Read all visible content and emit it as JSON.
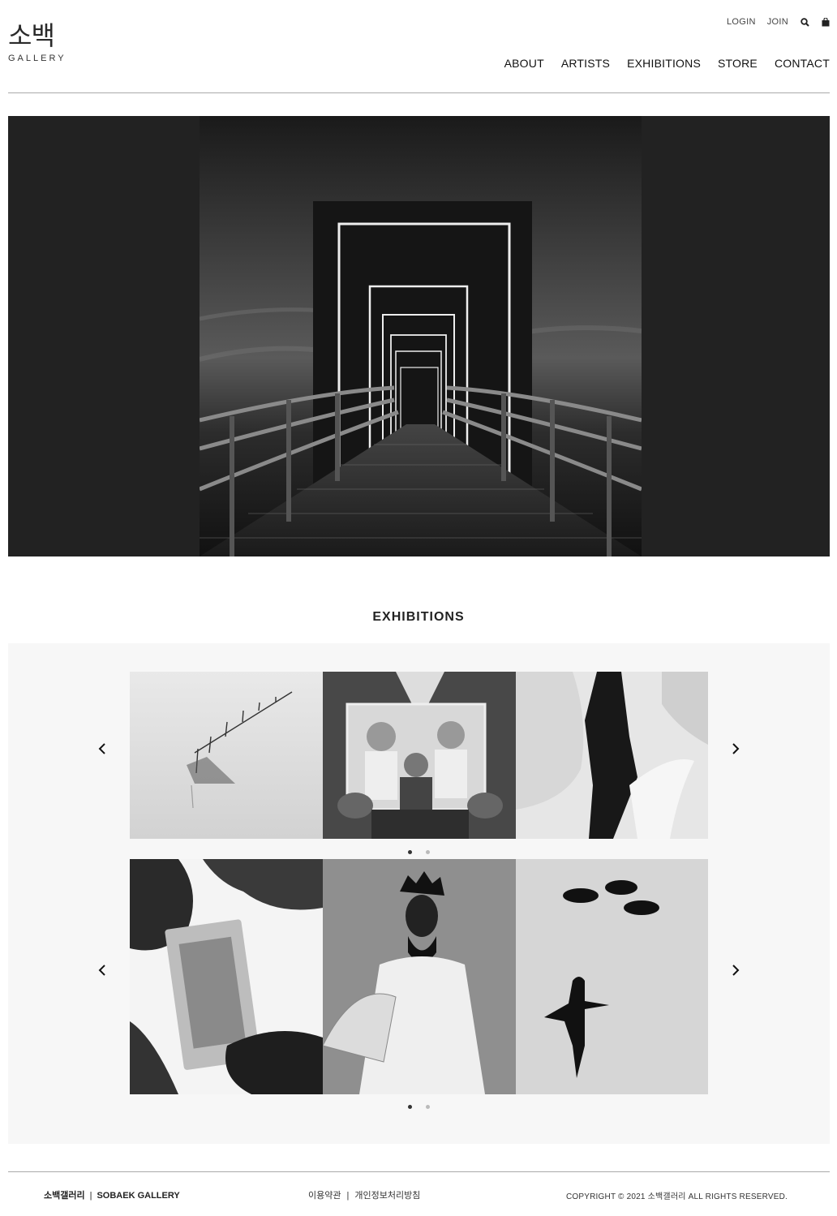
{
  "brand": {
    "logo_ko": "소백",
    "logo_en": "GALLERY"
  },
  "util_nav": {
    "login": "LOGIN",
    "join": "JOIN",
    "search_icon": "search-icon",
    "cart_icon": "bag-icon"
  },
  "nav": {
    "items": [
      "ABOUT",
      "ARTISTS",
      "EXHIBITIONS",
      "STORE",
      "CONTACT"
    ]
  },
  "hero": {
    "image": "black-and-white pier with illuminated square frames"
  },
  "exhibitions": {
    "title": "EXHIBITIONS",
    "slider_1": {
      "images": [
        "misty fence in water",
        "man holding family portrait",
        "ice formations"
      ],
      "page": 1,
      "pages": 2
    },
    "slider_2": {
      "images": [
        "fingers holding film negative",
        "masked dancer with fan",
        "swimmer beneath ducks"
      ],
      "page": 1,
      "pages": 2
    },
    "prev_icon": "chevron-left-icon",
    "next_icon": "chevron-right-icon"
  },
  "footer": {
    "name_ko": "소백갤러리",
    "name_en": "SOBAEK GALLERY",
    "terms": "이용약관",
    "privacy": "개인정보처리방침",
    "copyright": "COPYRIGHT © 2021 소백갤러리 ALL RIGHTS RESERVED."
  },
  "colors": {
    "hero_bg": "#222222",
    "section_bg": "#f7f7f7",
    "text": "#222222"
  }
}
